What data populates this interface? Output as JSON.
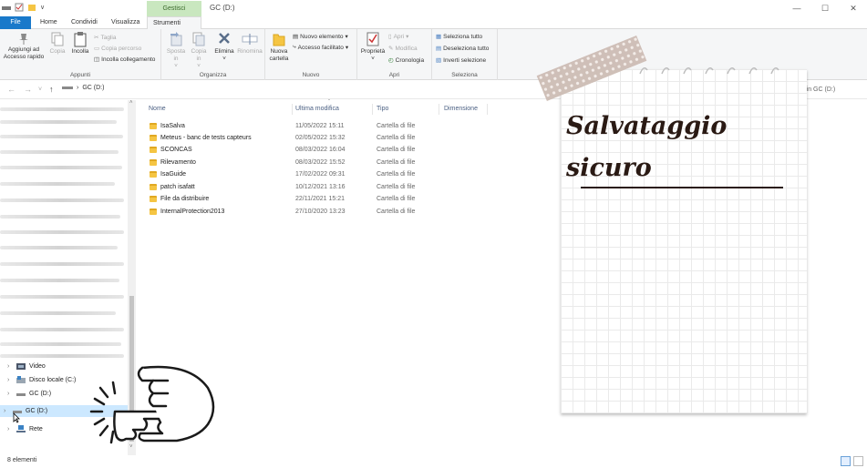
{
  "title_bar": {
    "context_tab": "Gestisci",
    "window_title": "GC (D:)",
    "controls": {
      "minimize": "—",
      "maximize": "☐",
      "close": "✕"
    }
  },
  "ribbon_tabs": [
    "File",
    "Home",
    "Condividi",
    "Visualizza",
    "Strumenti dischi"
  ],
  "ribbon": {
    "appunti": {
      "label": "Appunti",
      "aggiungi": "Aggiungi ad Accesso rapido",
      "copia": "Copia",
      "incolla": "Incolla",
      "taglia": "Taglia",
      "copia_percorso": "Copia percorso",
      "incolla_collegamento": "Incolla collegamento"
    },
    "organizza": {
      "label": "Organizza",
      "sposta": "Sposta in",
      "copia_in": "Copia in",
      "elimina": "Elimina",
      "rinomina": "Rinomina"
    },
    "nuovo": {
      "label": "Nuovo",
      "nuova_cartella": "Nuova cartella",
      "nuovo_elemento": "Nuovo elemento",
      "accesso_facilitato": "Accesso facilitato"
    },
    "apri": {
      "label": "Apri",
      "proprieta": "Proprietà",
      "apri": "Apri",
      "modifica": "Modifica",
      "cronologia": "Cronologia"
    },
    "seleziona": {
      "label": "Seleziona",
      "seleziona_tutto": "Seleziona tutto",
      "deseleziona_tutto": "Deseleziona tutto",
      "inverti": "Inverti selezione"
    }
  },
  "address": {
    "path": "GC (D:)",
    "search_fragment": "rca in GC (D:)"
  },
  "nav_pane": {
    "items": [
      {
        "label": "Video",
        "icon": "video-folder-icon"
      },
      {
        "label": "Disco locale (C:)",
        "icon": "drive-icon"
      },
      {
        "label": "GC (D:)",
        "icon": "removable-drive-icon"
      },
      {
        "label": "GC (D:)",
        "icon": "removable-drive-icon",
        "selected": true
      },
      {
        "label": "Rete",
        "icon": "network-icon"
      }
    ]
  },
  "columns": [
    "Nome",
    "Ultima modifica",
    "Tipo",
    "Dimensione"
  ],
  "files": [
    {
      "name": "IsaSalva",
      "date": "11/05/2022 15:11",
      "type": "Cartella di file"
    },
    {
      "name": "Meteus - banc de tests capteurs",
      "date": "02/05/2022 15:32",
      "type": "Cartella di file"
    },
    {
      "name": "SCONCAS",
      "date": "08/03/2022 16:04",
      "type": "Cartella di file"
    },
    {
      "name": "Rilevamento",
      "date": "08/03/2022 15:52",
      "type": "Cartella di file"
    },
    {
      "name": "IsaGuide",
      "date": "17/02/2022 09:31",
      "type": "Cartella di file"
    },
    {
      "name": "patch isafatt",
      "date": "10/12/2021 13:16",
      "type": "Cartella di file"
    },
    {
      "name": "File da distribuire",
      "date": "22/11/2021 15:21",
      "type": "Cartella di file"
    },
    {
      "name": "InternalProtection2013",
      "date": "27/10/2020 13:23",
      "type": "Cartella di file"
    }
  ],
  "status": {
    "count": "8 elementi"
  },
  "overlay": {
    "title_line1": "Salvataggio",
    "title_line2": "sicuro"
  },
  "colors": {
    "file_tab": "#1979ca",
    "context_tab": "#c9e7bf",
    "selection": "#cce8ff",
    "folder": "#f5c543",
    "card_ink": "#2a1a14"
  }
}
